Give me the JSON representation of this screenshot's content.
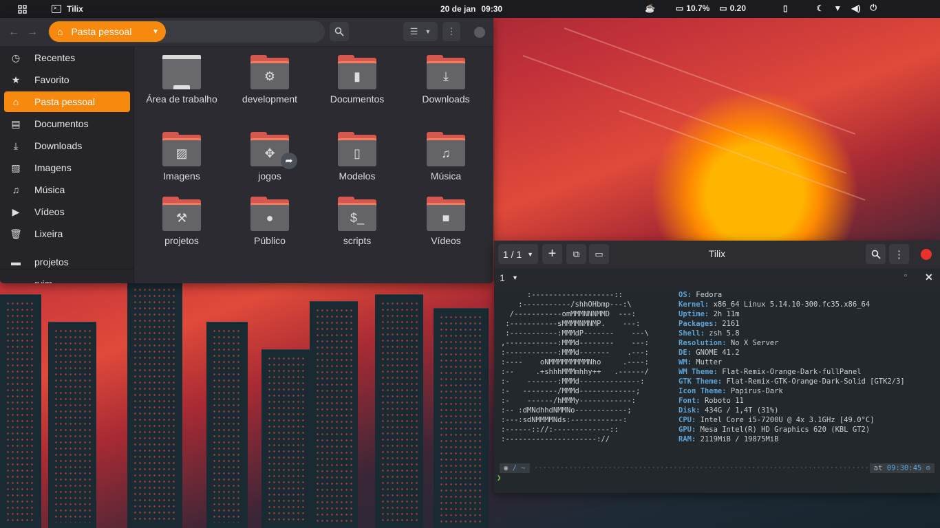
{
  "topbar": {
    "app_name": "Tilix",
    "date": "20 de jan",
    "time": "09:30",
    "battery": "10.7%",
    "load": "0.20"
  },
  "files": {
    "location_label": "Pasta pessoal",
    "sidebar": [
      {
        "label": "Recentes",
        "icon": "clock-icon",
        "glyph": "◷"
      },
      {
        "label": "Favorito",
        "icon": "star-icon",
        "glyph": "★"
      },
      {
        "label": "Pasta pessoal",
        "icon": "home-icon",
        "glyph": "⌂"
      },
      {
        "label": "Documentos",
        "icon": "document-icon",
        "glyph": "▤"
      },
      {
        "label": "Downloads",
        "icon": "download-icon",
        "glyph": "⤓"
      },
      {
        "label": "Imagens",
        "icon": "image-icon",
        "glyph": "▨"
      },
      {
        "label": "Música",
        "icon": "music-icon",
        "glyph": "♫"
      },
      {
        "label": "Vídeos",
        "icon": "video-icon",
        "glyph": "▶"
      },
      {
        "label": "Lixeira",
        "icon": "trash-icon",
        "glyph": "🗑"
      },
      {
        "label": "projetos",
        "icon": "folder-icon",
        "glyph": "▬"
      },
      {
        "label": "rvim",
        "icon": "folder-icon",
        "glyph": "▬"
      }
    ],
    "folders": [
      {
        "label": "Área de trabalho",
        "icon": "desktop-icon",
        "glyph": ""
      },
      {
        "label": "development",
        "icon": "gear-icon",
        "glyph": "⚙"
      },
      {
        "label": "Documentos",
        "icon": "document-icon",
        "glyph": "▮"
      },
      {
        "label": "Downloads",
        "icon": "download-icon",
        "glyph": "⤓"
      },
      {
        "label": "Imagens",
        "icon": "image-icon",
        "glyph": "▨"
      },
      {
        "label": "jogos",
        "icon": "gamepad-icon",
        "glyph": "✥"
      },
      {
        "label": "Modelos",
        "icon": "template-icon",
        "glyph": "▯"
      },
      {
        "label": "Música",
        "icon": "music-icon",
        "glyph": "♫"
      },
      {
        "label": "projetos",
        "icon": "tools-icon",
        "glyph": "⚒"
      },
      {
        "label": "Público",
        "icon": "user-icon",
        "glyph": "●"
      },
      {
        "label": "scripts",
        "icon": "terminal-icon",
        "glyph": "$_"
      },
      {
        "label": "Vídeos",
        "icon": "video-icon",
        "glyph": "■"
      }
    ]
  },
  "terminal": {
    "page_indicator": "1 / 1",
    "title": "Tilix",
    "session": "1",
    "ascii_art": [
      "      :-------------------::",
      "    :-----------/shhOHbmp---:\\",
      "  /-----------omMMMNNNMMD  ---:",
      " :-----------sMMMMNMNMP.    ---:",
      " :-----------:MMMdP-------    ---\\",
      ",------------:MMMd--------    ---:",
      ":------------:MMMd-------    .---:",
      ":----    oNMMMMMMMMMNho     .----:",
      ":--     .+shhhMMMmhhy++   .------/",
      ":-    -------:MMMd--------------:",
      ":-   --------/MMMd-------------;",
      ":-    ------/hMMMy------------:",
      ":-- :dMNdhhdNMMNo------------;",
      ":---:sdNMMMMNds:------------:",
      ":------:://:-------------::",
      ":---------------------://"
    ],
    "info": [
      {
        "key": "OS:",
        "value": "Fedora"
      },
      {
        "key": "Kernel:",
        "value": "x86_64 Linux 5.14.10-300.fc35.x86_64"
      },
      {
        "key": "Uptime:",
        "value": "2h 11m"
      },
      {
        "key": "Packages:",
        "value": "2161"
      },
      {
        "key": "Shell:",
        "value": "zsh 5.8"
      },
      {
        "key": "Resolution:",
        "value": "No X Server"
      },
      {
        "key": "DE:",
        "value": "GNOME 41.2"
      },
      {
        "key": "WM:",
        "value": "Mutter"
      },
      {
        "key": "WM Theme:",
        "value": "Flat-Remix-Orange-Dark-fullPanel"
      },
      {
        "key": "GTK Theme:",
        "value": "Flat-Remix-GTK-Orange-Dark-Solid [GTK2/3]"
      },
      {
        "key": "Icon Theme:",
        "value": "Papirus-Dark"
      },
      {
        "key": "Font:",
        "value": "Roboto 11"
      },
      {
        "key": "Disk:",
        "value": "434G / 1,4T (31%)"
      },
      {
        "key": "CPU:",
        "value": "Intel Core i5-7200U @ 4x 3.1GHz [49.0°C]"
      },
      {
        "key": "GPU:",
        "value": "Mesa Intel(R) HD Graphics 620 (KBL GT2)"
      },
      {
        "key": "RAM:",
        "value": "2119MiB / 19875MiB"
      }
    ],
    "prompt": {
      "path": "/ ~",
      "at_label": "at",
      "time": "09:30:45",
      "caret": "❯"
    }
  },
  "colors": {
    "accent": "#f7890f",
    "folder": "#d6574f",
    "term_key": "#5ea2d6"
  }
}
